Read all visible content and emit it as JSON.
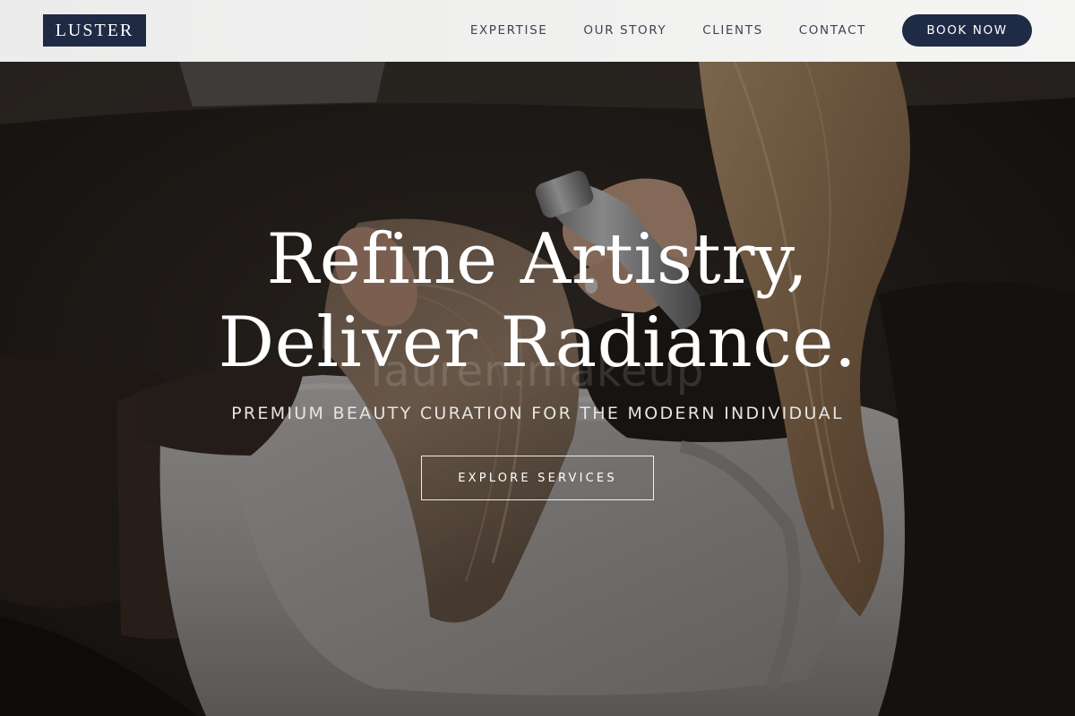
{
  "header": {
    "logo": "LUSTER",
    "nav": [
      {
        "label": "EXPERTISE"
      },
      {
        "label": "OUR STORY"
      },
      {
        "label": "CLIENTS"
      },
      {
        "label": "CONTACT"
      }
    ],
    "cta": "BOOK NOW"
  },
  "hero": {
    "title_line1": "Refine Artistry,",
    "title_line2": "Deliver Radiance.",
    "subtitle": "PREMIUM BEAUTY CURATION FOR THE MODERN INDIVIDUAL",
    "button": "EXPLORE SERVICES",
    "watermark": "lauren.makeup"
  },
  "colors": {
    "brand_navy": "#1f2a44",
    "header_bg": "#efefee",
    "nav_text": "#3e4452",
    "hero_text": "#ffffff"
  },
  "icons": {
    "hero_image": "hair-wash-salon-photo"
  }
}
